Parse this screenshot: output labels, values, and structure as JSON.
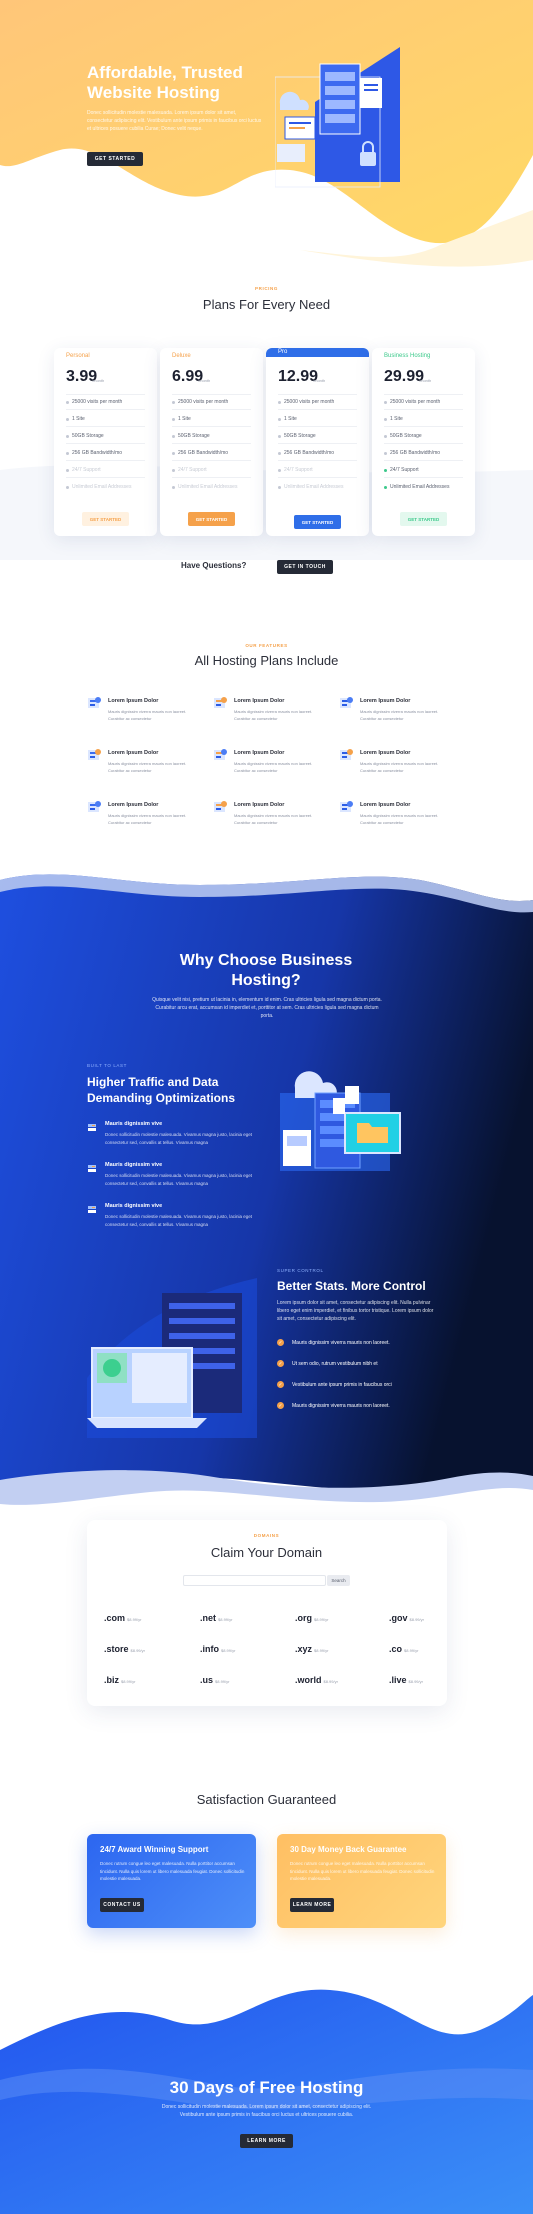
{
  "hero": {
    "title": "Affordable, Trusted Website Hosting",
    "description": "Donec sollicitudin molestie malesuada. Lorem ipsum dolor sit amet, consectetur adipiscing elit. Vestibulum ante ipsum primis in faucibus orci luctus et ultrices posuere cubilia Curae; Donec velit neque.",
    "button": "GET STARTED"
  },
  "pricing": {
    "label": "PRICING",
    "title": "Plans For Every Need",
    "plans": [
      {
        "name": "Personal",
        "price": "3.99",
        "per": "/month",
        "features": [
          "25000 visits per month",
          "1 Site",
          "50GB Storage",
          "256 GB Bandwidth/mo",
          "24/7 Support",
          "Unlimited Email Addresses"
        ],
        "button": "GET STARTED",
        "color": "#f5a14a"
      },
      {
        "name": "Deluxe",
        "price": "6.99",
        "per": "/month",
        "features": [
          "25000 visits per month",
          "1 Site",
          "50GB Storage",
          "256 GB Bandwidth/mo",
          "24/7 Support",
          "Unlimited Email Addresses"
        ],
        "button": "GET STARTED",
        "color": "#f5a14a"
      },
      {
        "name": "Pro",
        "price": "12.99",
        "per": "/month",
        "features": [
          "25000 visits per month",
          "1 Site",
          "50GB Storage",
          "256 GB Bandwidth/mo",
          "24/7 Support",
          "Unlimited Email Addresses"
        ],
        "button": "GET STARTED",
        "color": "#2f6ee8"
      },
      {
        "name": "Business Hosting",
        "price": "29.99",
        "per": "/month",
        "features": [
          "25000 visits per month",
          "1 Site",
          "50GB Storage",
          "256 GB Bandwidth/mo",
          "24/7 Support",
          "Unlimited Email Addresses"
        ],
        "button": "GET STARTED",
        "color": "#3cc98b"
      }
    ],
    "questions": "Have Questions?",
    "questions_button": "GET IN TOUCH"
  },
  "features": {
    "label": "OUR FEATURES",
    "title": "All Hosting Plans Include",
    "items": [
      {
        "title": "Lorem Ipsum Dolor",
        "desc": "Mauris dignissim viverra mauris non laoreet. Curabitur ac consectetur"
      },
      {
        "title": "Lorem Ipsum Dolor",
        "desc": "Mauris dignissim viverra mauris non laoreet. Curabitur ac consectetur"
      },
      {
        "title": "Lorem Ipsum Dolor",
        "desc": "Mauris dignissim viverra mauris non laoreet. Curabitur ac consectetur"
      },
      {
        "title": "Lorem Ipsum Dolor",
        "desc": "Mauris dignissim viverra mauris non laoreet. Curabitur ac consectetur"
      },
      {
        "title": "Lorem Ipsum Dolor",
        "desc": "Mauris dignissim viverra mauris non laoreet. Curabitur ac consectetur"
      },
      {
        "title": "Lorem Ipsum Dolor",
        "desc": "Mauris dignissim viverra mauris non laoreet. Curabitur ac consectetur"
      },
      {
        "title": "Lorem Ipsum Dolor",
        "desc": "Mauris dignissim viverra mauris non laoreet. Curabitur ac consectetur"
      },
      {
        "title": "Lorem Ipsum Dolor",
        "desc": "Mauris dignissim viverra mauris non laoreet. Curabitur ac consectetur"
      },
      {
        "title": "Lorem Ipsum Dolor",
        "desc": "Mauris dignissim viverra mauris non laoreet. Curabitur ac consectetur"
      }
    ]
  },
  "why": {
    "title": "Why Choose Business Hosting?",
    "desc": "Quisque velit nisi, pretium ut lacinia in, elementum id enim. Cras ultricies ligula sed magna dictum porta. Curabitur arcu erat, accumsan id imperdiet et, porttitor at sem. Cras ultricies ligula sed magna dictum porta."
  },
  "traffic": {
    "label": "BUILT TO LAST",
    "title": "Higher Traffic and Data Demanding Optimizations",
    "items": [
      {
        "title": "Mauris dignissim vive",
        "desc": "Donec sollicitudin molestie malesuada. Vivamus magna justo, lacinia eget consectetur sed, convallis at tellus. Vivamus magna"
      },
      {
        "title": "Mauris dignissim vive",
        "desc": "Donec sollicitudin molestie malesuada. Vivamus magna justo, lacinia eget consectetur sed, convallis at tellus. Vivamus magna"
      },
      {
        "title": "Mauris dignissim vive",
        "desc": "Donec sollicitudin molestie malesuada. Vivamus magna justo, lacinia eget consectetur sed, convallis at tellus. Vivamus magna"
      }
    ]
  },
  "stats": {
    "label": "SUPER CONTROL",
    "title": "Better Stats. More Control",
    "desc": "Lorem ipsum dolor sit amet, consectetur adipiscing elit. Nulla pulvinar libero eget enim imperdiet, et finibus tortor tristique. Lorem ipsum dolor sit amet, consectetur adipiscing elit.",
    "items": [
      "Mauris dignissim viverra mauris non laoreet.",
      "Ut sem odio, rutrum vestibulum nibh et",
      "Vestibulum ante ipsum primis in faucibus orci",
      "Mauris dignissim viverra mauris non laoreet."
    ]
  },
  "domain": {
    "label": "DOMAINS",
    "title": "Claim Your Domain",
    "search_button": "Search",
    "tlds": [
      {
        "name": ".com",
        "price": "$8.99/yr"
      },
      {
        "name": ".net",
        "price": "$8.99/yr"
      },
      {
        "name": ".org",
        "price": "$8.99/yr"
      },
      {
        "name": ".gov",
        "price": "$8.99/yr"
      },
      {
        "name": ".store",
        "price": "$8.99/yr"
      },
      {
        "name": ".info",
        "price": "$8.99/yr"
      },
      {
        "name": ".xyz",
        "price": "$8.99/yr"
      },
      {
        "name": ".co",
        "price": "$8.99/yr"
      },
      {
        "name": ".biz",
        "price": "$8.99/yr"
      },
      {
        "name": ".us",
        "price": "$8.99/yr"
      },
      {
        "name": ".world",
        "price": "$8.99/yr"
      },
      {
        "name": ".live",
        "price": "$8.99/yr"
      }
    ]
  },
  "satisfaction": {
    "title": "Satisfaction Guaranteed",
    "left": {
      "title": "24/7 Award Winning Support",
      "desc": "Donec rutrum congue leo eget malesuada. Nulla porttitor accumsan tincidunt. Nulla quis lorem ut libero malesuada feugiat. Donec sollicitudin molestie malesuada.",
      "button": "CONTACT US"
    },
    "right": {
      "title": "30 Day Money Back Guarantee",
      "desc": "Donec rutrum congue leo eget malesuada. Nulla porttitor accumsan tincidunt. Nulla quis lorem ut libero malesuada feugiat. Donec sollicitudin molestie malesuada.",
      "button": "LEARN MORE"
    }
  },
  "footer": {
    "title": "30 Days of Free Hosting",
    "desc": "Donec sollicitudin molestie malesuada. Lorem ipsum dolor sit amet, consectetur adipiscing elit. Vestibulum ante ipsum primis in faucibus orci luctus et ultrices posuere cubilia.",
    "button": "LEARN MORE"
  }
}
